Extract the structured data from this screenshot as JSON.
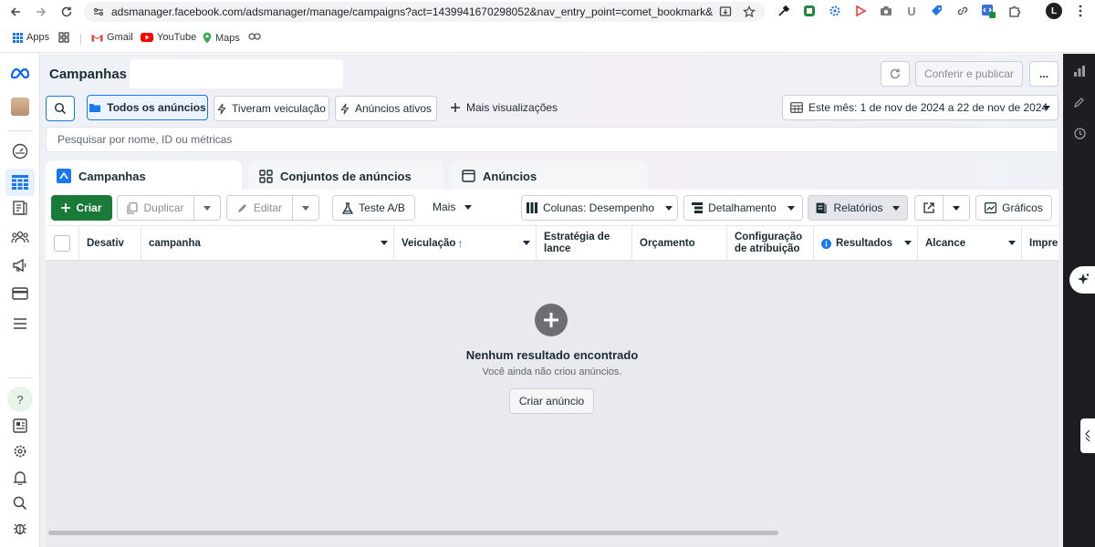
{
  "browser": {
    "url": "adsmanager.facebook.com/adsmanager/manage/campaigns?act=1439941670298052&nav_entry_point=comet_bookmark&breakdow...",
    "profile_initial": "L",
    "bookmarks": [
      {
        "label": "Apps",
        "icon": "apps-grid-icon"
      },
      {
        "label": "Gmail",
        "icon": "gmail-icon"
      },
      {
        "label": "YouTube",
        "icon": "youtube-icon"
      },
      {
        "label": "Maps",
        "icon": "maps-icon"
      }
    ]
  },
  "header": {
    "title": "Campanhas",
    "review_publish": "Conferir e publicar",
    "more": "..."
  },
  "filters": {
    "all_ads": "Todos os anúncios",
    "had_delivery": "Tiveram veiculação",
    "active_ads": "Anúncios ativos",
    "more_views": "Mais visualizações",
    "date_range": "Este mês: 1 de nov de 2024 a 22 de nov de 2024"
  },
  "search": {
    "placeholder": "Pesquisar por nome, ID ou métricas"
  },
  "tabs": [
    {
      "label": "Campanhas"
    },
    {
      "label": "Conjuntos de anúncios"
    },
    {
      "label": "Anúncios"
    }
  ],
  "toolbar": {
    "create": "Criar",
    "duplicate": "Duplicar",
    "edit": "Editar",
    "ab_test": "Teste A/B",
    "more": "Mais",
    "columns": "Colunas: Desempenho",
    "breakdown": "Detalhamento",
    "reports": "Relatórios",
    "charts": "Gráficos"
  },
  "table": {
    "columns": [
      "Desativ",
      "campanha",
      "Veiculação",
      "Estratégia de lance",
      "Orçamento",
      "Configuração de atribuição",
      "Resultados",
      "Alcance",
      "Impres"
    ]
  },
  "empty_state": {
    "title": "Nenhum resultado encontrado",
    "subtitle": "Você ainda não criou anúncios.",
    "button": "Criar anúncio"
  }
}
